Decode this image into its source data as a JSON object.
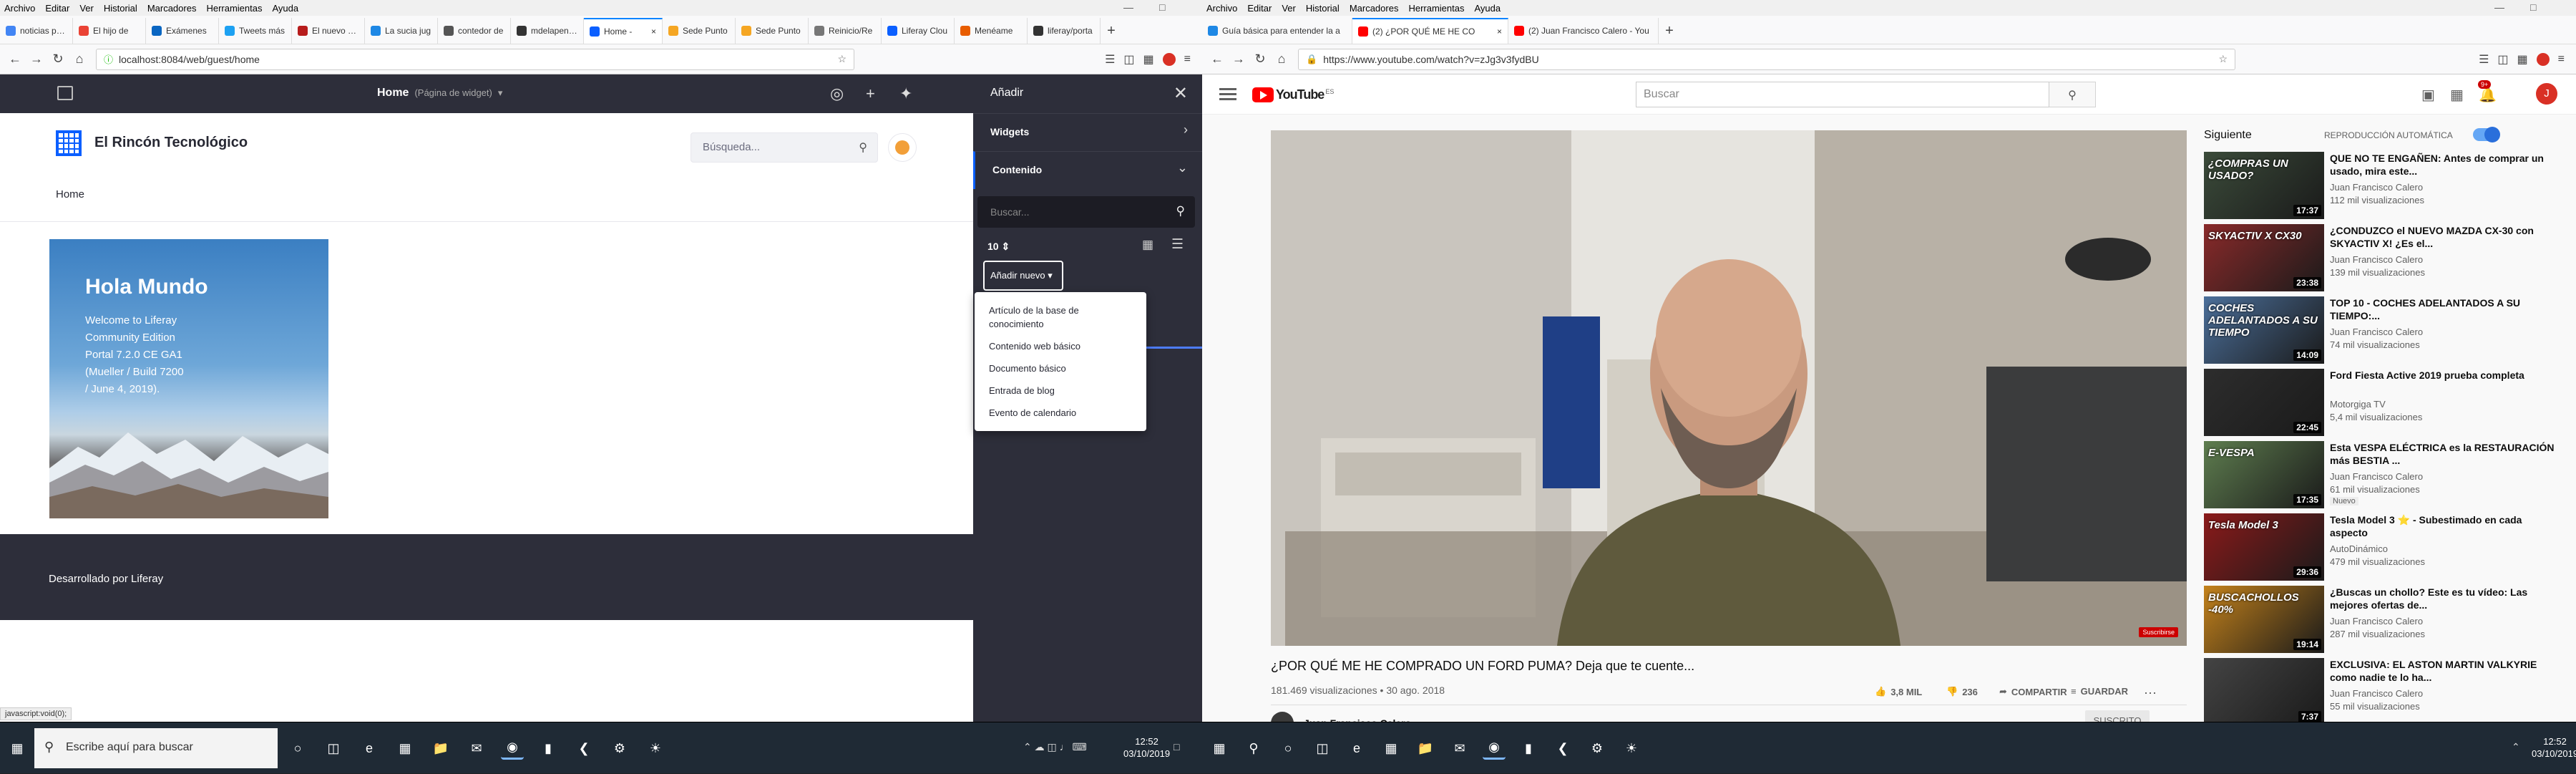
{
  "left_browser": {
    "menu": [
      "Archivo",
      "Editar",
      "Ver",
      "Historial",
      "Marcadores",
      "Herramientas",
      "Ayuda"
    ],
    "tabs": [
      {
        "label": "noticias para",
        "color": "#4285f4"
      },
      {
        "label": "El hijo de",
        "color": "#ea4335"
      },
      {
        "label": "Exámenes",
        "color": "#0a66c2"
      },
      {
        "label": "Tweets más",
        "color": "#1da1f2"
      },
      {
        "label": "El nuevo Ho",
        "color": "#b71c1c"
      },
      {
        "label": "La sucia jug",
        "color": "#1e88e5"
      },
      {
        "label": "contedor de",
        "color": "#555555"
      },
      {
        "label": "mdelapengu",
        "color": "#333333"
      },
      {
        "label": "Home -",
        "color": "#0b5fff",
        "active": true
      },
      {
        "label": "Sede Punto",
        "color": "#f5a623"
      },
      {
        "label": "Sede Punto",
        "color": "#f5a623"
      },
      {
        "label": "Reinicio/Re",
        "color": "#777777"
      },
      {
        "label": "Liferay Clou",
        "color": "#0b5fff"
      },
      {
        "label": "Menéame",
        "color": "#e85d00"
      },
      {
        "label": "liferay/porta",
        "color": "#333333"
      }
    ],
    "url": "localhost:8084/web/guest/home"
  },
  "liferay": {
    "page_title": "Home",
    "page_subtitle": "(Página de widget)",
    "site_name": "El Rincón Tecnológico",
    "search_placeholder": "Búsqueda...",
    "nav_home": "Home",
    "hero_title": "Hola Mundo",
    "hero_text": "Welcome to Liferay Community Edition Portal 7.2.0 CE GA1 (Mueller / Build 7200 / June 4, 2019).",
    "footer": "Desarrollado por Liferay",
    "status": "javascript:void(0);"
  },
  "add_panel": {
    "title": "Añadir",
    "widgets": "Widgets",
    "content": "Contenido",
    "search_placeholder": "Buscar...",
    "count": "10",
    "add_new": "Añadir nuevo",
    "menu": [
      "Artículo de la base de conocimiento",
      "Contenido web básico",
      "Documento básico",
      "Entrada de blog",
      "Evento de calendario"
    ]
  },
  "right_browser": {
    "menu": [
      "Archivo",
      "Editar",
      "Ver",
      "Historial",
      "Marcadores",
      "Herramientas",
      "Ayuda"
    ],
    "tabs": [
      {
        "label": "Guía básica para entender la a",
        "color": "#1e88e5"
      },
      {
        "label": "(2) ¿POR QUÉ ME HE CO",
        "color": "#ff0000",
        "active": true
      },
      {
        "label": "(2) Juan Francisco Calero - You",
        "color": "#ff0000"
      }
    ],
    "url": "https://www.youtube.com/watch?v=zJg3v3fydBU"
  },
  "youtube": {
    "country": "ES",
    "search_placeholder": "Buscar",
    "notif_count": "9+",
    "avatar_letter": "J",
    "video_title": "¿POR QUÉ ME HE COMPRADO UN FORD PUMA? Deja que te cuente...",
    "views": "181.469 visualizaciones • 30 ago. 2018",
    "likes": "3,8 MIL",
    "dislikes": "236",
    "share": "COMPARTIR",
    "save": "GUARDAR",
    "channel": "Juan Francisco Calero",
    "subscribed": "SUSCRITO",
    "subscribe_badge": "Suscribirse",
    "next_label": "Siguiente",
    "autoplay": "REPRODUCCIÓN AUTOMÁTICA",
    "recommended": [
      {
        "title": "QUE NO TE ENGAÑEN: Antes de comprar un usado, mira este...",
        "channel": "Juan Francisco Calero",
        "views": "112 mil visualizaciones",
        "duration": "17:37",
        "caption": "¿COMPRAS UN USADO?",
        "thumb": "#3b4b3a"
      },
      {
        "title": "¿CONDUZCO el NUEVO MAZDA CX-30 con SKYACTIV X! ¿Es el...",
        "channel": "Juan Francisco Calero",
        "views": "139 mil visualizaciones",
        "duration": "23:38",
        "caption": "SKYACTIV X CX30",
        "thumb": "#8a2a2a"
      },
      {
        "title": "TOP 10 - COCHES ADELANTADOS A SU TIEMPO:...",
        "channel": "Juan Francisco Calero",
        "views": "74 mil visualizaciones",
        "duration": "14:09",
        "caption": "COCHES ADELANTADOS A SU TIEMPO",
        "thumb": "#4b6f9a"
      },
      {
        "title": "Ford Fiesta Active 2019 prueba completa",
        "channel": "Motorgiga TV",
        "views": "5,4 mil visualizaciones",
        "duration": "22:45",
        "caption": "",
        "thumb": "#2d2d2d"
      },
      {
        "title": "Esta VESPA ELÉCTRICA es la RESTAURACIÓN más BESTIA ...",
        "channel": "Juan Francisco Calero",
        "views": "61 mil visualizaciones",
        "duration": "17:35",
        "caption": "E-VESPA",
        "thumb": "#5e7d4f",
        "badge": "Nuevo"
      },
      {
        "title": "Tesla Model 3 ⭐ - Subestimado en cada aspecto",
        "channel": "AutoDinámico",
        "views": "479 mil visualizaciones",
        "duration": "29:36",
        "caption": "Tesla Model 3",
        "thumb": "#8b1a1a"
      },
      {
        "title": "¿Buscas un chollo? Este es tu vídeo: Las mejores ofertas de...",
        "channel": "Juan Francisco Calero",
        "views": "287 mil visualizaciones",
        "duration": "19:14",
        "caption": "BUSCACHOLLOS -40%",
        "thumb": "#c4821b"
      },
      {
        "title": "EXCLUSIVA: EL ASTON MARTIN VALKYRIE como nadie te lo ha...",
        "channel": "Juan Francisco Calero",
        "views": "55 mil visualizaciones",
        "duration": "7:37",
        "caption": "",
        "thumb": "#444444"
      }
    ]
  },
  "taskbar": {
    "search": "Escribe aquí para buscar",
    "time": "12:52",
    "date": "03/10/2019"
  }
}
